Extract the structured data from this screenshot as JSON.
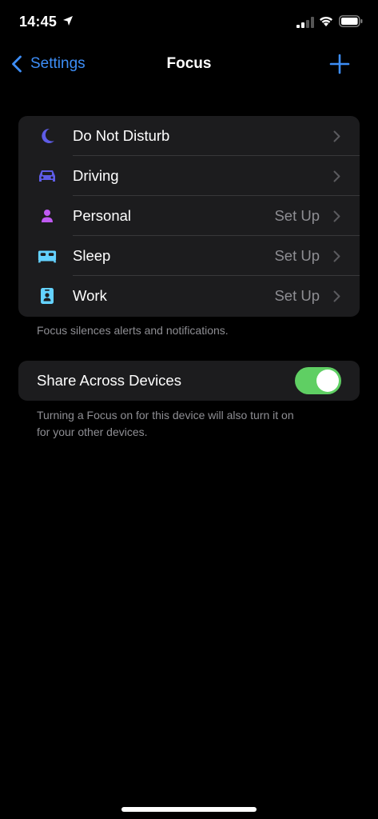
{
  "status": {
    "time": "14:45"
  },
  "nav": {
    "back_label": "Settings",
    "title": "Focus"
  },
  "focus_list": [
    {
      "label": "Do Not Disturb",
      "value": "",
      "icon": "moon-icon",
      "color": "#5e5ce6"
    },
    {
      "label": "Driving",
      "value": "",
      "icon": "car-icon",
      "color": "#5e5ce6"
    },
    {
      "label": "Personal",
      "value": "Set Up",
      "icon": "person-icon",
      "color": "#bf5af2"
    },
    {
      "label": "Sleep",
      "value": "Set Up",
      "icon": "bed-icon",
      "color": "#64d2ff"
    },
    {
      "label": "Work",
      "value": "Set Up",
      "icon": "id-badge-icon",
      "color": "#64d2ff"
    }
  ],
  "focus_footer": "Focus silences alerts and notifications.",
  "share": {
    "label": "Share Across Devices",
    "enabled": true,
    "footer_line1": "Turning a Focus on for this device will also turn it on",
    "footer_line2": "for your other devices."
  },
  "colors": {
    "accent": "#3d8ef7",
    "toggle_on": "#5fcf63",
    "cell_bg": "#1c1c1e",
    "secondary_text": "#8e8e93"
  }
}
